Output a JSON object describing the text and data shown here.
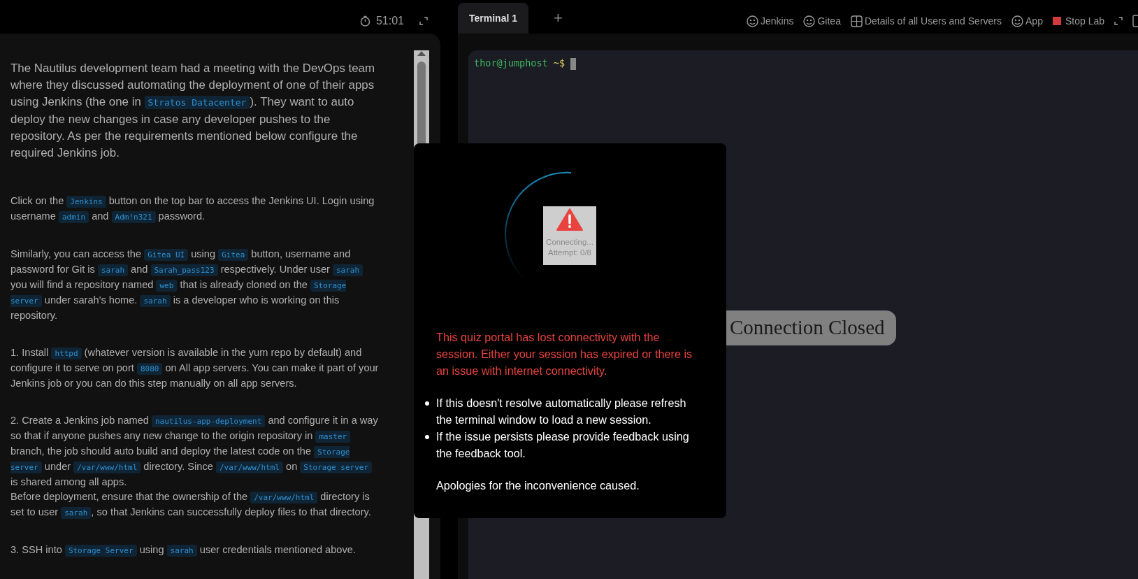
{
  "timer": {
    "text": "51:01"
  },
  "tabs": [
    {
      "label": "Terminal 1",
      "selected": true
    }
  ],
  "add_tab": {
    "label": "+"
  },
  "toolbar": [
    {
      "label": "Jenkins",
      "kind": "service"
    },
    {
      "label": "Gitea",
      "kind": "service"
    },
    {
      "label": "Details of all Users and Servers",
      "kind": "details"
    },
    {
      "label": "App",
      "kind": "service"
    },
    {
      "label": "Stop Lab",
      "kind": "stop"
    }
  ],
  "task": [
    {
      "kind": "intro",
      "parts": [
        {
          "t": "The Nautilus development team had a meeting with the DevOps team where they discussed automating the deployment of one of their apps using Jenkins (the one in "
        },
        {
          "c": "Stratos Datacenter"
        },
        {
          "t": "). They want to auto deploy the new changes in case any developer pushes to the repository. As per the requirements mentioned below configure the required Jenkins job."
        }
      ]
    },
    {
      "kind": "paragraph",
      "parts": [
        {
          "t": "Click on the "
        },
        {
          "c": "Jenkins"
        },
        {
          "t": " button on the top bar to access the Jenkins UI. Login using username "
        },
        {
          "c": "admin"
        },
        {
          "t": " and "
        },
        {
          "c": "Adm!n321"
        },
        {
          "t": " password."
        }
      ]
    },
    {
      "kind": "paragraph",
      "parts": [
        {
          "t": "Similarly, you can access the "
        },
        {
          "c": "Gitea UI"
        },
        {
          "t": " using "
        },
        {
          "c": "Gitea"
        },
        {
          "t": " button, username and password for Git is "
        },
        {
          "c": "sarah"
        },
        {
          "t": " and "
        },
        {
          "c": "Sarah_pass123"
        },
        {
          "t": " respectively. Under user "
        },
        {
          "c": "sarah"
        },
        {
          "t": " you will find a repository named "
        },
        {
          "c": "web"
        },
        {
          "t": " that is already cloned on the "
        },
        {
          "c": "Storage server"
        },
        {
          "t": " under sarah's home. "
        },
        {
          "c": "sarah"
        },
        {
          "t": " is a developer who is working on this repository."
        }
      ]
    },
    {
      "kind": "paragraph",
      "parts": [
        {
          "t": "1. Install "
        },
        {
          "c": "httpd"
        },
        {
          "t": " (whatever version is available in the yum repo by default) and configure it to serve on port "
        },
        {
          "c": "8080"
        },
        {
          "t": " on All app servers. You can make it part of your Jenkins job or you can do this step manually on all app servers."
        }
      ]
    },
    {
      "kind": "paragraph",
      "parts": [
        {
          "t": "2. Create a Jenkins job named "
        },
        {
          "c": "nautilus-app-deployment"
        },
        {
          "t": " and configure it in a way so that if anyone pushes any new change to the origin repository in "
        },
        {
          "c": "master"
        },
        {
          "t": " branch, the job should auto build and deploy the latest code on the "
        },
        {
          "c": "Storage server"
        },
        {
          "t": " under "
        },
        {
          "c": "/var/www/html"
        },
        {
          "t": " directory. Since "
        },
        {
          "c": "/var/www/html"
        },
        {
          "t": " on "
        },
        {
          "c": "Storage server"
        },
        {
          "t": " is shared among all apps."
        }
      ]
    },
    {
      "kind": "continuation",
      "parts": [
        {
          "t": "Before deployment, ensure that the ownership of the "
        },
        {
          "c": "/var/www/html"
        },
        {
          "t": " directory is set to user "
        },
        {
          "c": "sarah"
        },
        {
          "t": ", so that Jenkins can successfully deploy files to that directory."
        }
      ]
    },
    {
      "kind": "paragraph",
      "parts": [
        {
          "t": "3. SSH into "
        },
        {
          "c": "Storage Server"
        },
        {
          "t": " using "
        },
        {
          "c": "sarah"
        },
        {
          "t": " user credentials mentioned above."
        }
      ]
    }
  ],
  "terminal": {
    "user_host": "thor@jumphost",
    "prompt": "~$"
  },
  "dialog": {
    "status": "Connecting...",
    "attempt": "Attempt: 0/8",
    "error": "This quiz portal has lost connectivity with the session. Either your session has expired or there is an issue with internet connectivity.",
    "bullets": [
      "If this doesn't resolve automatically please refresh the terminal window to load a new session.",
      "If the issue persists please provide feedback using the feedback tool."
    ],
    "closing": "Apologies for the inconvenience caused."
  },
  "connection_badge": "Connection Closed"
}
